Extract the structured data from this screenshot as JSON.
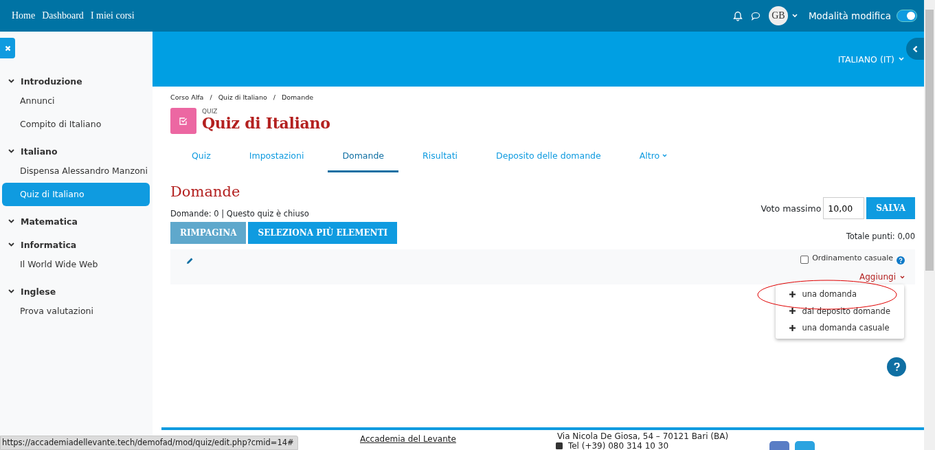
{
  "navbar": {
    "links": [
      "Home",
      "Dashboard",
      "I miei corsi"
    ],
    "avatar_initials": "GB",
    "edit_mode": {
      "label": "Modalità modifica",
      "on": true
    }
  },
  "sidebar": {
    "sections": [
      {
        "title": "Introduzione",
        "expanded": true,
        "items": [
          {
            "label": "Annunci",
            "selected": false
          },
          {
            "label": "Compito di Italiano",
            "selected": false
          }
        ]
      },
      {
        "title": "Italiano",
        "expanded": true,
        "items": [
          {
            "label": "Dispensa Alessandro Manzoni",
            "selected": false
          },
          {
            "label": "Quiz di Italiano",
            "selected": true
          }
        ]
      },
      {
        "title": "Matematica",
        "expanded": true
      },
      {
        "title": "Informatica",
        "expanded": true,
        "items": [
          {
            "label": "Il World Wide Web",
            "selected": false
          }
        ]
      },
      {
        "title": "Inglese",
        "expanded": true,
        "items": [
          {
            "label": "Prova valutazioni",
            "selected": false
          }
        ]
      }
    ]
  },
  "header": {
    "language": "ITALIANO (IT)"
  },
  "breadcrumb": [
    {
      "label": "Corso Alfa",
      "separator": "/"
    },
    {
      "label": "Quiz di Italiano",
      "separator": "/"
    },
    {
      "label": "Domande"
    }
  ],
  "activity": {
    "type_label": "QUIZ",
    "title": "Quiz di Italiano"
  },
  "tabs": [
    {
      "label": "Quiz",
      "selected": false,
      "kind": "link"
    },
    {
      "label": "Impostazioni",
      "selected": false,
      "kind": "link"
    },
    {
      "label": "Domande",
      "selected": true,
      "kind": "link"
    },
    {
      "label": "Risultati",
      "selected": false,
      "kind": "link"
    },
    {
      "label": "Deposito delle domande",
      "selected": false,
      "kind": "link"
    },
    {
      "label": "Altro",
      "selected": false,
      "kind": "dropdown"
    }
  ],
  "page_title": "Domande",
  "summary": "Domande: 0 | Questo quiz è chiuso",
  "max_grade": {
    "label": "Voto massimo",
    "value": "10,00",
    "button": "SALVA"
  },
  "buttons": [
    {
      "label": "RIMPAGINA",
      "disabled": true
    },
    {
      "label": "SELEZIONA PIÙ ELEMENTI",
      "disabled": false
    }
  ],
  "total_points": "Totale punti: 0,00",
  "section": {
    "shuffle": {
      "label": "Ordinamento casuale",
      "checked": false
    },
    "add_menu": {
      "label": "Aggiungi",
      "expanded": true,
      "items": [
        {
          "label": "una domanda",
          "circled": true
        },
        {
          "label": "dal deposito domande",
          "circled": false
        },
        {
          "label": "una domanda casuale",
          "circled": false
        }
      ]
    }
  },
  "footer": {
    "link": "Accademia del Levante",
    "address": "Via Nicola De Giosa, 54 – 70121 Bari (BA)",
    "phone": "Tel (+39) 080 314 10 30"
  },
  "status_url": "https://accademiadellevante.tech/demofad/mod/quiz/edit.php?cmid=14#"
}
